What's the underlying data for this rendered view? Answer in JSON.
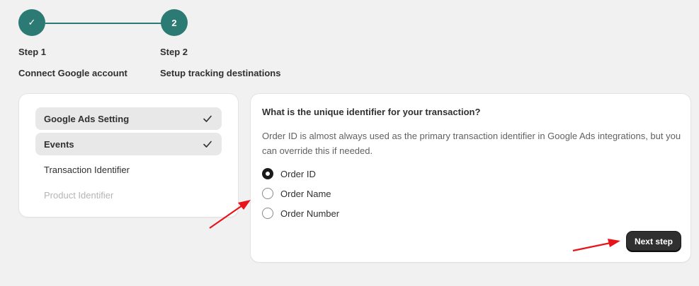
{
  "stepper": {
    "steps": [
      {
        "badge": "✓",
        "title": "Step 1",
        "subtitle": "Connect Google account"
      },
      {
        "badge": "2",
        "title": "Step 2",
        "subtitle": "Setup tracking destinations"
      }
    ],
    "accent_color": "#2b7a73"
  },
  "sidebar": {
    "items": [
      {
        "label": "Google Ads Setting",
        "state": "completed"
      },
      {
        "label": "Events",
        "state": "completed"
      },
      {
        "label": "Transaction Identifier",
        "state": "current"
      },
      {
        "label": "Product Identifier",
        "state": "disabled"
      }
    ]
  },
  "main": {
    "question": "What is the unique identifier for your transaction?",
    "description": "Order ID is almost always used as the primary transaction identifier in Google Ads integrations, but you can override this if needed.",
    "options": [
      {
        "label": "Order ID",
        "checked": true
      },
      {
        "label": "Order Name",
        "checked": false
      },
      {
        "label": "Order Number",
        "checked": false
      }
    ],
    "next_label": "Next step"
  },
  "annotation_color": "#e8141a"
}
